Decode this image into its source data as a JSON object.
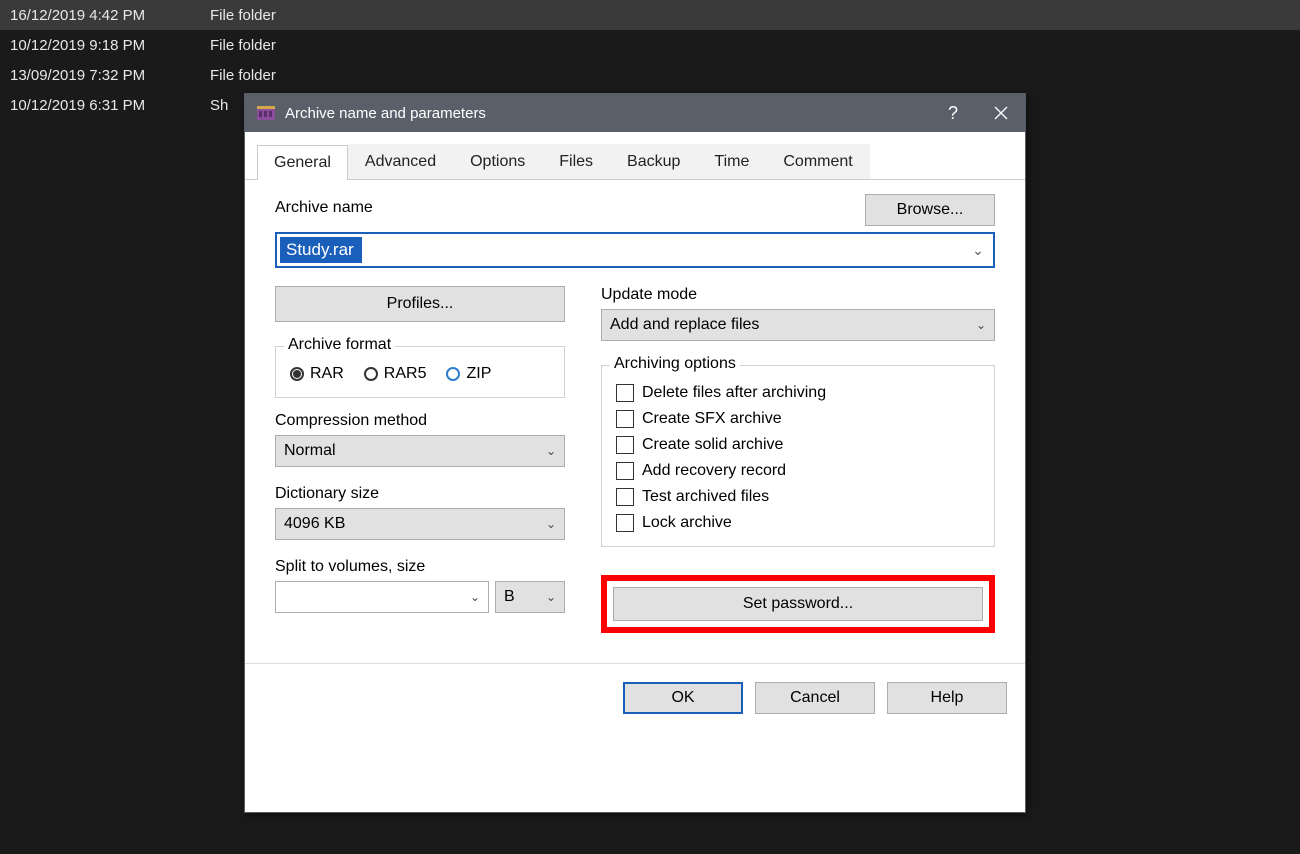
{
  "explorer": {
    "rows": [
      {
        "date": "16/12/2019 4:42 PM",
        "type": "File folder",
        "highlight": true
      },
      {
        "date": "10/12/2019 9:18 PM",
        "type": "File folder",
        "highlight": false
      },
      {
        "date": "13/09/2019 7:32 PM",
        "type": "File folder",
        "highlight": false
      },
      {
        "date": "10/12/2019 6:31 PM",
        "type": "Sh",
        "highlight": false
      }
    ]
  },
  "dialog": {
    "title": "Archive name and parameters",
    "tabs": [
      "General",
      "Advanced",
      "Options",
      "Files",
      "Backup",
      "Time",
      "Comment"
    ],
    "active_tab": 0,
    "archive_name_label": "Archive name",
    "browse_button": "Browse...",
    "archive_name_value": "Study.rar",
    "profiles_button": "Profiles...",
    "update_mode_label": "Update mode",
    "update_mode_value": "Add and replace files",
    "archive_format": {
      "legend": "Archive format",
      "options": [
        "RAR",
        "RAR5",
        "ZIP"
      ],
      "selected": "RAR"
    },
    "compression_label": "Compression method",
    "compression_value": "Normal",
    "dictionary_label": "Dictionary size",
    "dictionary_value": "4096 KB",
    "split_label": "Split to volumes, size",
    "split_value": "",
    "split_unit": "B",
    "archiving_options": {
      "legend": "Archiving options",
      "items": [
        "Delete files after archiving",
        "Create SFX archive",
        "Create solid archive",
        "Add recovery record",
        "Test archived files",
        "Lock archive"
      ]
    },
    "set_password_button": "Set password...",
    "ok_button": "OK",
    "cancel_button": "Cancel",
    "help_button": "Help"
  }
}
